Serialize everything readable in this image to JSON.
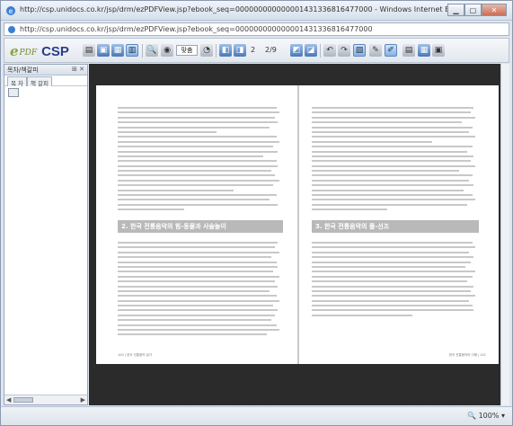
{
  "window": {
    "title": "http://csp.unidocs.co.kr/jsp/drm/ezPDFView.jsp?ebook_seq=000000000000001431336816477000 - Windows Internet Explorer",
    "url": "http://csp.unidocs.co.kr/jsp/drm/ezPDFView.jsp?ebook_seq=000000000000001431336816477000",
    "buttons": {
      "minimize": "▭",
      "maximize": "▭",
      "close": "✕"
    }
  },
  "toolbar": {
    "logo_e": "e",
    "logo_pdf": "PDF",
    "logo_csp": "CSP",
    "zoom_value": "맞춤",
    "page_current": "2",
    "page_total": "2/9"
  },
  "left_panel": {
    "title": "목차/책갈피",
    "controls": "⊞ ✕",
    "tab_1": "목 차",
    "tab_2": "책 갈피",
    "scroll_left": "◀",
    "scroll_right": "▶"
  },
  "document": {
    "left_page": {
      "heading": "2. 한국 전통음악의 힘-동물과 사슬놀이",
      "footer": "100 | 한국 전통음악 읽기"
    },
    "right_page": {
      "heading": "3. 한국 전통음악의 풀-선조",
      "footer": "한국 전통음악의 이해 | 101"
    }
  },
  "status": {
    "zoom": "100%"
  },
  "colors": {
    "logo_green": "#8aa33b",
    "logo_blue": "#2b3d8a",
    "doc_background": "#2b2b2b",
    "heading_bar": "#b9b9b9"
  }
}
